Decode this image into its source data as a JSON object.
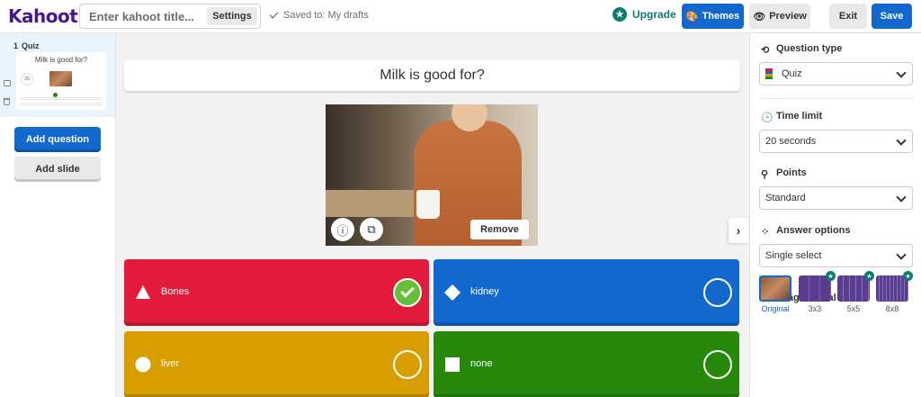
{
  "header": {
    "logo": "Kahoot!",
    "title_placeholder": "Enter kahoot title...",
    "settings_label": "Settings",
    "saved_text": "Saved to: My drafts",
    "upgrade_label": "Upgrade",
    "themes_label": "Themes",
    "preview_label": "Preview",
    "exit_label": "Exit",
    "save_label": "Save"
  },
  "sidebar": {
    "slides": [
      {
        "number": "1",
        "type": "Quiz",
        "title": "Milk is good for?",
        "timer": "20"
      }
    ],
    "add_question_label": "Add question",
    "add_slide_label": "Add slide"
  },
  "editor": {
    "question": "Milk is good for?",
    "media": {
      "remove_label": "Remove"
    },
    "answers": [
      {
        "text": "Bones",
        "shape": "triangle",
        "color": "#e21b3c",
        "correct": true
      },
      {
        "text": "kidney",
        "shape": "diamond",
        "color": "#1368ce",
        "correct": false
      },
      {
        "text": "liver",
        "shape": "circle",
        "color": "#d89e00",
        "correct": false
      },
      {
        "text": "none",
        "shape": "square",
        "color": "#26890c",
        "correct": false
      }
    ]
  },
  "panel": {
    "question_type": {
      "label": "Question type",
      "value": "Quiz"
    },
    "time_limit": {
      "label": "Time limit",
      "value": "20 seconds"
    },
    "points": {
      "label": "Points",
      "value": "Standard"
    },
    "answer_options": {
      "label": "Answer options",
      "value": "Single select"
    },
    "image_reveal": {
      "label": "Image reveal",
      "options": [
        "Original",
        "3x3",
        "5x5",
        "8x8"
      ],
      "selected": "Original"
    }
  },
  "colors": {
    "brand_purple": "#46178f",
    "primary_blue": "#1368ce",
    "upgrade_teal": "#0f7a72"
  }
}
